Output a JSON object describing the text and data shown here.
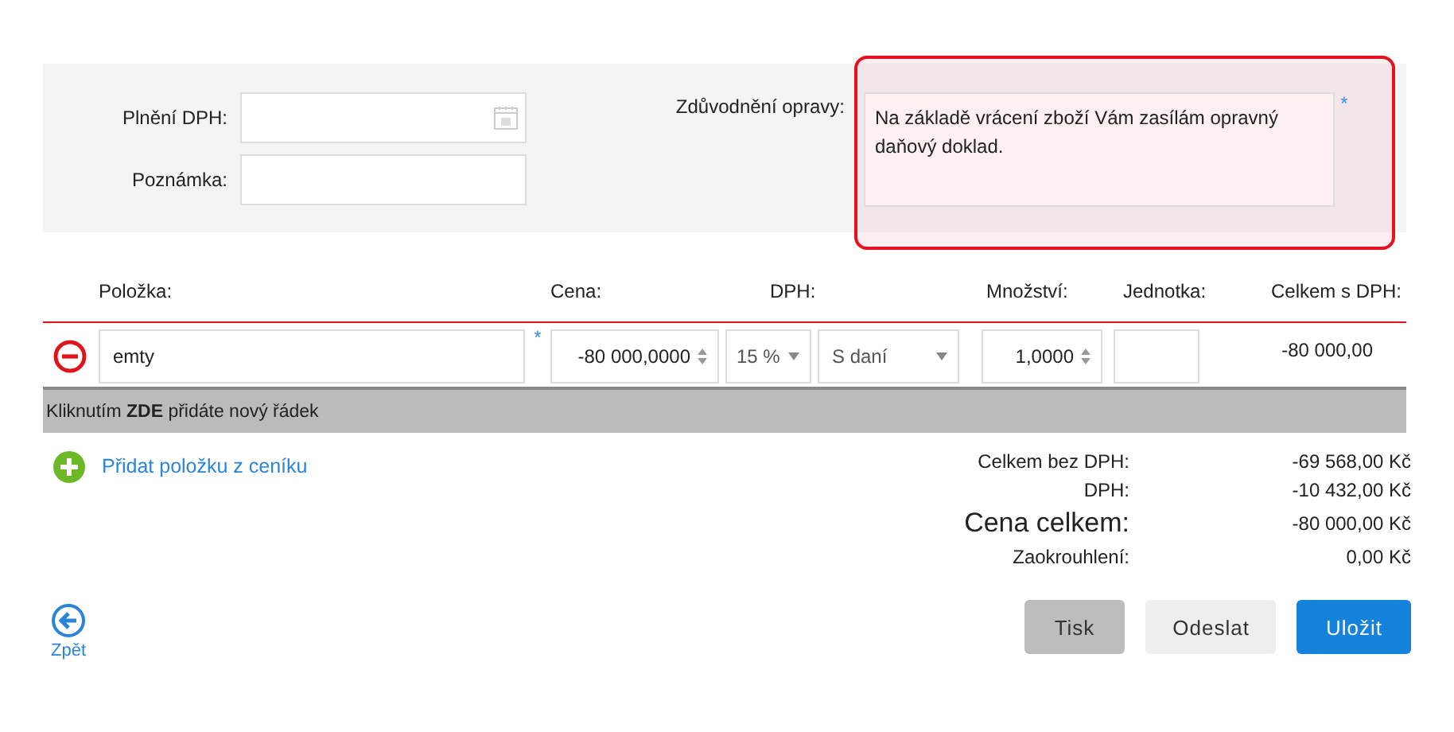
{
  "form": {
    "fields": [
      {
        "label": "Plnění DPH:",
        "kind": "date"
      },
      {
        "label": "Poznámka:",
        "kind": "text"
      }
    ],
    "reason": {
      "label": "Zdůvodnění opravy:",
      "value": "Na základě vrácení zboží Vám zasílám opravný daňový doklad.",
      "required_mark": "*",
      "highlighted": true
    }
  },
  "table": {
    "columns": [
      "Položka:",
      "Cena:",
      "DPH:",
      "Množství:",
      "Jednotka:",
      "Celkem s DPH:"
    ],
    "rows": [
      {
        "item": "emty",
        "required_mark": "*",
        "price": "-80 000,0000",
        "vat_rate": "15 %",
        "vat_mode": "S daní",
        "quantity": "1,0000",
        "total": "-80 000,00"
      }
    ]
  },
  "add_row_bar": "Kliknutím **ZDE** přidáte nový řádek",
  "add_from_pricelist": "Přidat položku z ceníku",
  "summary": [
    {
      "label": "Celkem bez DPH:",
      "value": "-69 568,00 Kč",
      "emphasis": false
    },
    {
      "label": "DPH:",
      "value": "-10 432,00 Kč",
      "emphasis": false
    },
    {
      "label": "Cena celkem:",
      "value": "-80 000,00 Kč",
      "emphasis": true
    },
    {
      "label": "Zaokrouhlení:",
      "value": "0,00 Kč",
      "emphasis": false
    }
  ],
  "back": "Zpět",
  "buttons": [
    {
      "label": "Tisk",
      "kind": "muted"
    },
    {
      "label": "Odeslat",
      "kind": "plain"
    },
    {
      "label": "Uložit",
      "kind": "primary"
    }
  ]
}
